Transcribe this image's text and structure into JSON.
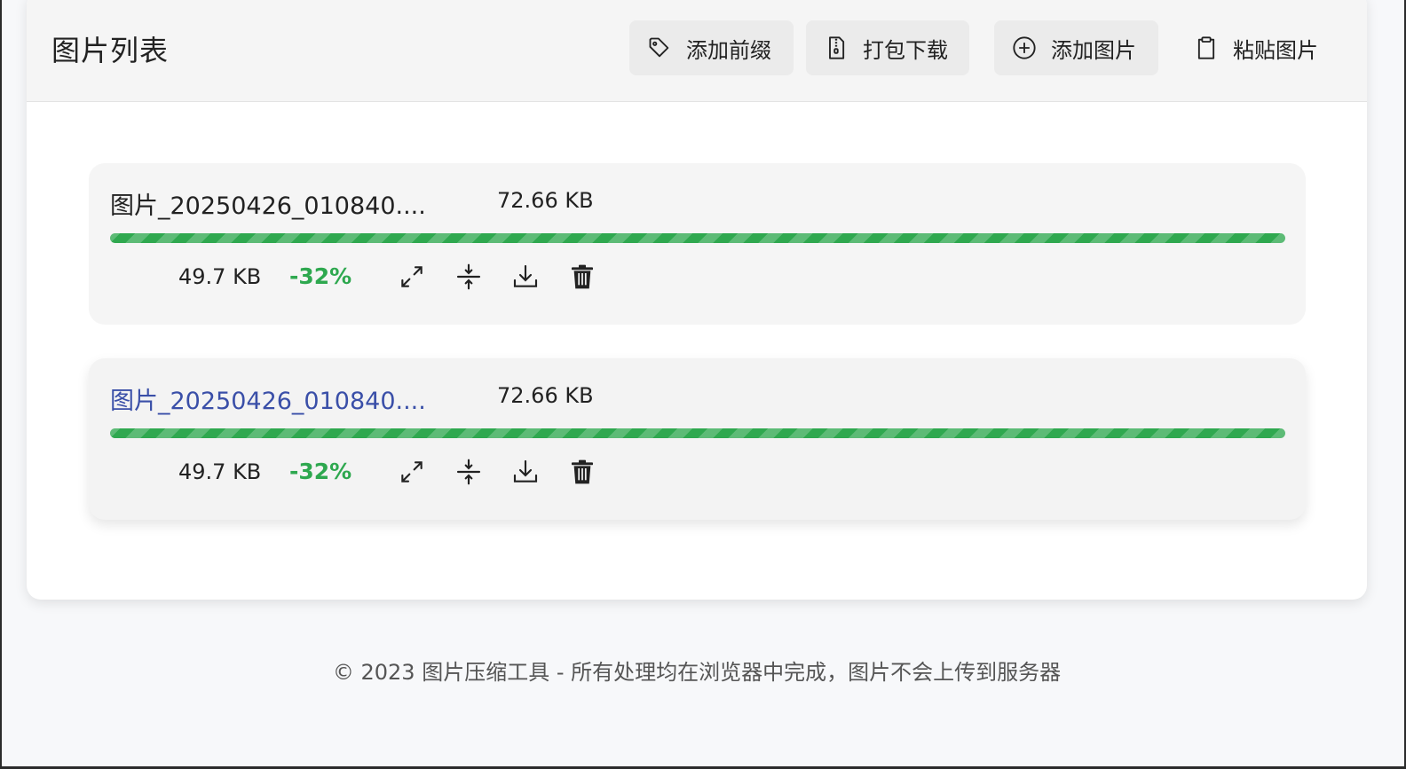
{
  "header": {
    "title": "图片列表",
    "buttons": {
      "add_prefix": "添加前缀",
      "pack_download": "打包下载",
      "add_image": "添加图片",
      "paste_image": "粘贴图片"
    }
  },
  "files": [
    {
      "name": "图片_20250426_010840....",
      "original_size": "72.66 KB",
      "compressed_size": "49.7 KB",
      "reduction": "-32%",
      "progress": 1.0
    },
    {
      "name": "图片_20250426_010840....",
      "original_size": "72.66 KB",
      "compressed_size": "49.7 KB",
      "reduction": "-32%",
      "progress": 1.0
    }
  ],
  "footer": {
    "text": "© 2023 图片压缩工具 - 所有处理均在浏览器中完成，图片不会上传到服务器"
  },
  "colors": {
    "accent_green": "#2ea84f",
    "link_blue": "#3a4fa8",
    "card_bg": "#f5f5f5"
  },
  "icons": [
    "tag-icon",
    "zip-file-icon",
    "plus-circle-icon",
    "clipboard-icon",
    "expand-icon",
    "compress-icon",
    "download-icon",
    "trash-icon"
  ]
}
